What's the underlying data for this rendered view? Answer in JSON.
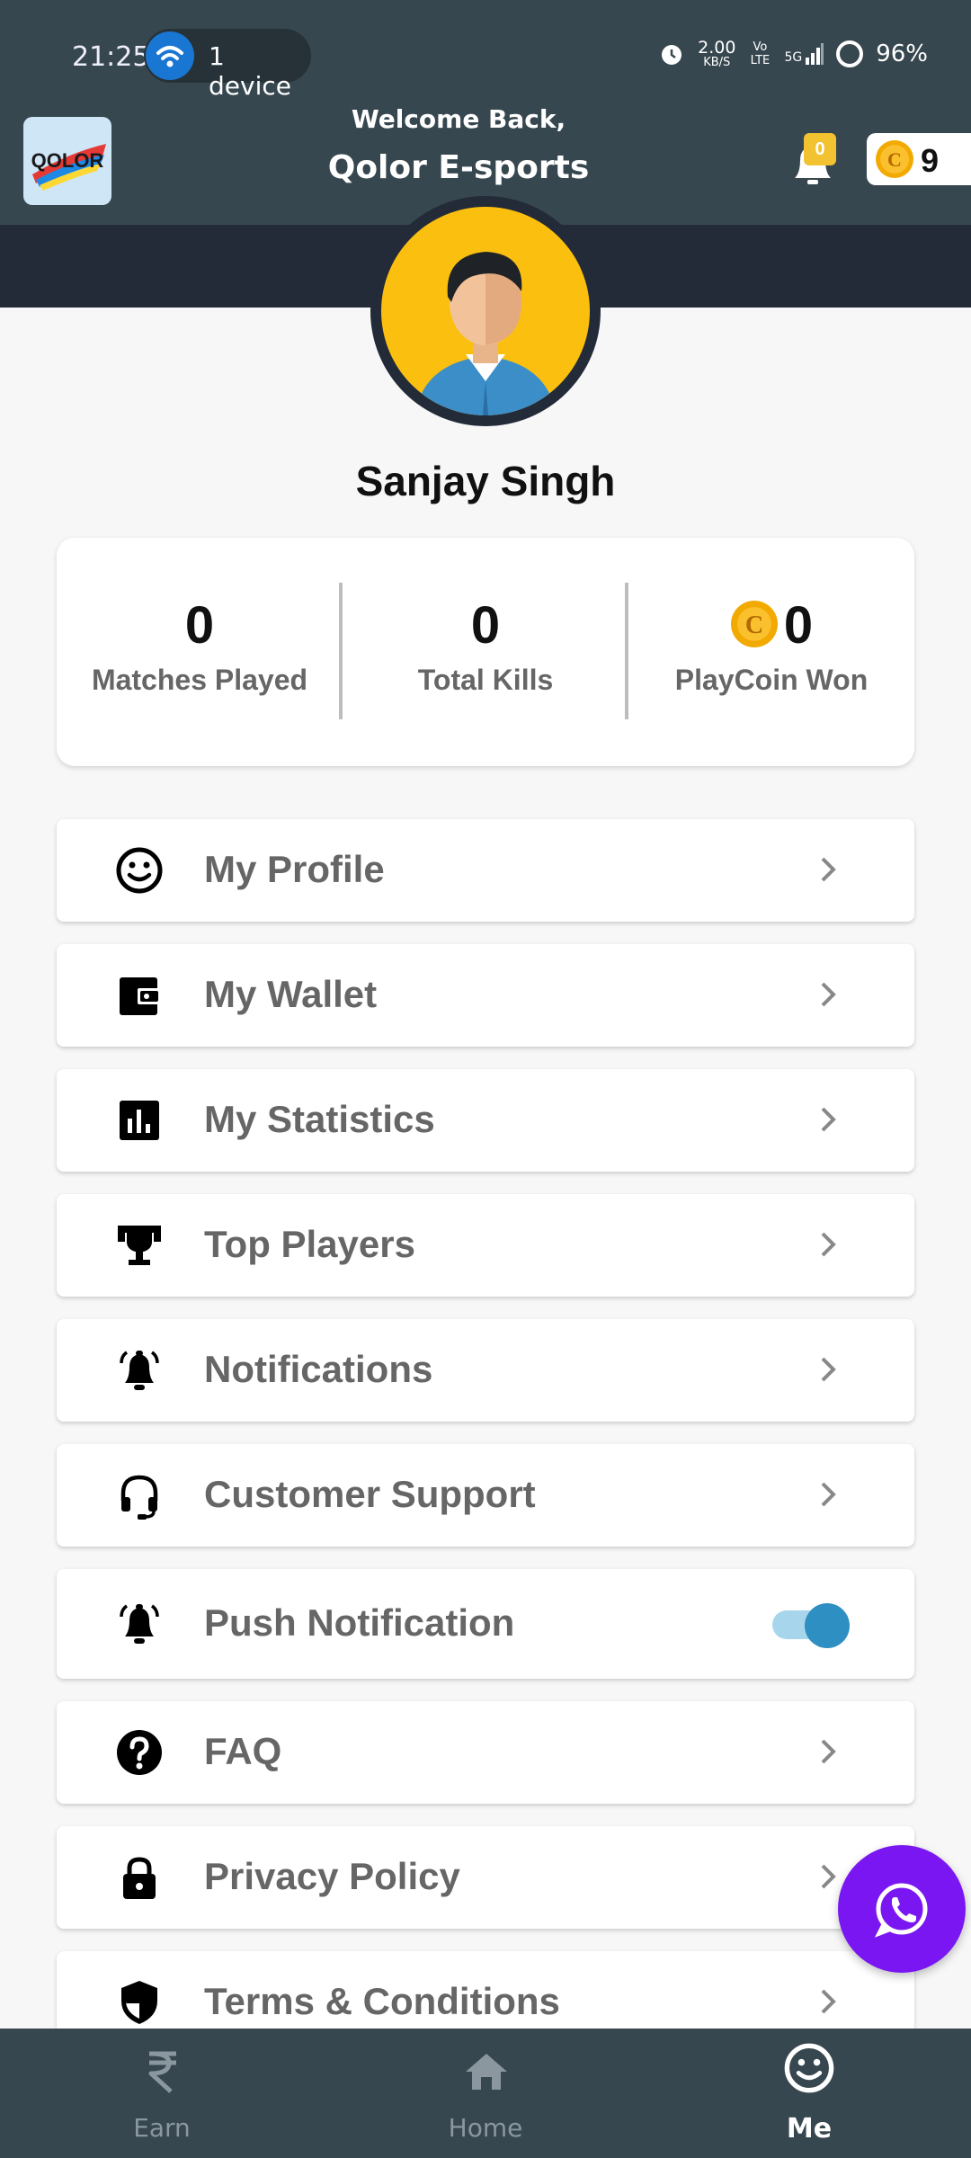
{
  "status_bar": {
    "time": "21:25",
    "device_pill": "1 device",
    "speed_value": "2.00",
    "speed_unit": "KB/S",
    "volte": "Vo LTE",
    "network": "5G",
    "battery": "96%"
  },
  "header": {
    "logo_text": "QOLOR",
    "welcome": "Welcome Back,",
    "brand": "Qolor E-sports",
    "notification_count": "0",
    "coin_balance": "9"
  },
  "profile": {
    "name": "Sanjay Singh"
  },
  "stats": [
    {
      "value": "0",
      "label": "Matches Played"
    },
    {
      "value": "0",
      "label": "Total Kills"
    },
    {
      "value": "0",
      "label": "PlayCoin Won"
    }
  ],
  "menu": [
    {
      "label": "My Profile",
      "icon": "smiley-icon"
    },
    {
      "label": "My Wallet",
      "icon": "wallet-icon"
    },
    {
      "label": "My Statistics",
      "icon": "bar-chart-icon"
    },
    {
      "label": "Top Players",
      "icon": "trophy-icon"
    },
    {
      "label": "Notifications",
      "icon": "bell-ring-icon"
    },
    {
      "label": "Customer Support",
      "icon": "headset-icon"
    },
    {
      "label": "Push Notification",
      "icon": "bell-ring-icon",
      "toggle_on": true
    },
    {
      "label": "FAQ",
      "icon": "question-icon"
    },
    {
      "label": "Privacy Policy",
      "icon": "lock-icon"
    },
    {
      "label": "Terms & Conditions",
      "icon": "shield-icon"
    }
  ],
  "bottom_nav": [
    {
      "label": "Earn",
      "icon": "rupee-icon"
    },
    {
      "label": "Home",
      "icon": "home-icon"
    },
    {
      "label": "Me",
      "icon": "smiley-icon",
      "active": true
    }
  ],
  "colors": {
    "header_bg": "#37474f",
    "band_bg": "#232a38",
    "avatar_bg": "#fbbf0f",
    "fab_bg": "#7a16f2",
    "toggle_knob": "#2e8fc2",
    "coin": "#f2a900"
  }
}
